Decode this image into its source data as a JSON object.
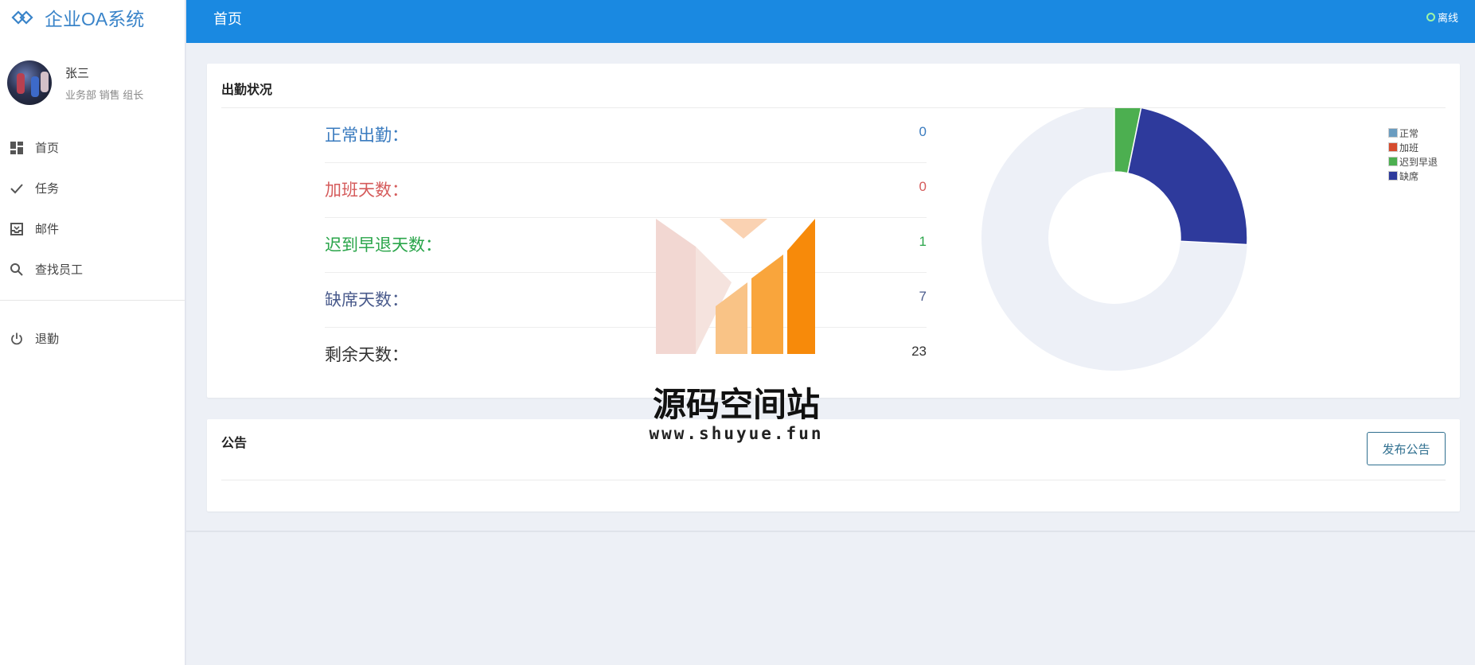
{
  "app": {
    "title": "企业OA系统"
  },
  "user": {
    "name": "张三",
    "department": "业务部 销售 组长"
  },
  "nav": {
    "items": [
      {
        "label": "首页",
        "icon": "dashboard-icon"
      },
      {
        "label": "任务",
        "icon": "check-icon"
      },
      {
        "label": "邮件",
        "icon": "inbox-icon"
      },
      {
        "label": "查找员工",
        "icon": "search-icon"
      }
    ],
    "logout": {
      "label": "退勤",
      "icon": "power-icon"
    }
  },
  "header": {
    "title": "首页",
    "status": "离线"
  },
  "attendance": {
    "title": "出勤状况",
    "stats": [
      {
        "label": "正常出勤：",
        "value": "0",
        "color": "#3a7bbf"
      },
      {
        "label": "加班天数：",
        "value": "0",
        "color": "#d55b5b"
      },
      {
        "label": "迟到早退天数：",
        "value": "1",
        "color": "#2aa54a"
      },
      {
        "label": "缺席天数：",
        "value": "7",
        "color": "#4a5b8c"
      },
      {
        "label": "剩余天数：",
        "value": "23",
        "color": "#333333"
      }
    ]
  },
  "chart_data": {
    "type": "pie",
    "donut": true,
    "total_ring_color": "#edf0f7",
    "series": [
      {
        "name": "正常",
        "value": 0,
        "color": "#6a9cc0"
      },
      {
        "name": "加班",
        "value": 0,
        "color": "#d64b2e"
      },
      {
        "name": "迟到早退",
        "value": 1,
        "color": "#4caf50"
      },
      {
        "name": "缺席",
        "value": 7,
        "color": "#2e3a9c"
      }
    ],
    "remaining": 23,
    "legend_position": "top-right"
  },
  "notice": {
    "title": "公告",
    "publish_label": "发布公告"
  },
  "watermark": {
    "name": "源码空间站",
    "url": "www.shuyue.fun"
  }
}
